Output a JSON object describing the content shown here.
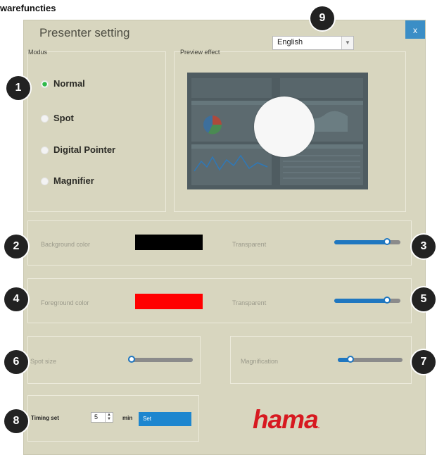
{
  "caption": "warefuncties",
  "window": {
    "title": "Presenter setting",
    "close_label": "x",
    "language": {
      "selected": "English"
    }
  },
  "modus": {
    "label": "Modus",
    "options": [
      {
        "label": "Normal",
        "checked": true
      },
      {
        "label": "Spot",
        "checked": false
      },
      {
        "label": "Digital Pointer",
        "checked": false
      },
      {
        "label": "Magnifier",
        "checked": false
      }
    ]
  },
  "preview": {
    "label": "Preview effect"
  },
  "background": {
    "label": "Background color",
    "color": "#000000",
    "transparent_label": "Transparent",
    "transparency": 0.8
  },
  "foreground": {
    "label": "Foreground color",
    "color": "#ff0000",
    "transparent_label": "Transparent",
    "transparency": 0.8
  },
  "spot_size": {
    "label": "Spot size",
    "value": 0.0
  },
  "magnification": {
    "label": "Magnification",
    "value": 0.2
  },
  "timing": {
    "label": "Timing set",
    "value": "5",
    "unit": "min",
    "set_label": "Set"
  },
  "logo": {
    "text": "hama",
    "suffix": "."
  },
  "badges": [
    "1",
    "2",
    "3",
    "4",
    "5",
    "6",
    "7",
    "8",
    "9"
  ],
  "colors": {
    "accent": "#1d86cf",
    "window_bg": "#d8d6bf",
    "logo": "#d71920"
  }
}
